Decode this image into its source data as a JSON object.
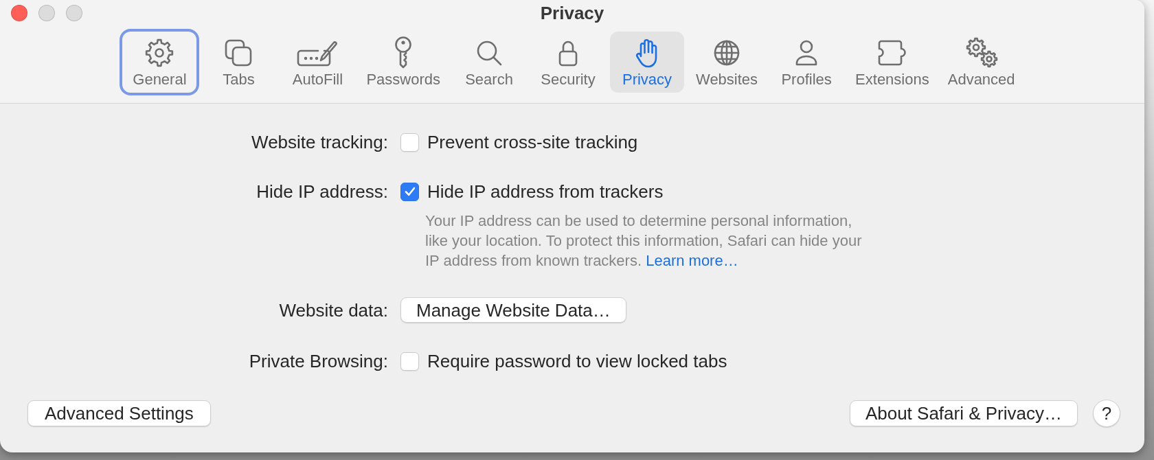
{
  "window": {
    "title": "Privacy",
    "controls": [
      {
        "color": "#ff5f57"
      },
      {
        "color": "#dcdcdc"
      },
      {
        "color": "#dcdcdc"
      }
    ]
  },
  "toolbar": [
    {
      "kind": "general",
      "label": "General",
      "selected": false,
      "focused": true
    },
    {
      "kind": "tabs",
      "label": "Tabs",
      "selected": false,
      "focused": false
    },
    {
      "kind": "autofill",
      "label": "AutoFill",
      "selected": false,
      "focused": false
    },
    {
      "kind": "passwords",
      "label": "Passwords",
      "selected": false,
      "focused": false
    },
    {
      "kind": "search",
      "label": "Search",
      "selected": false,
      "focused": false
    },
    {
      "kind": "security",
      "label": "Security",
      "selected": false,
      "focused": false
    },
    {
      "kind": "privacy",
      "label": "Privacy",
      "selected": true,
      "focused": false
    },
    {
      "kind": "websites",
      "label": "Websites",
      "selected": false,
      "focused": false
    },
    {
      "kind": "profiles",
      "label": "Profiles",
      "selected": false,
      "focused": false
    },
    {
      "kind": "extensions",
      "label": "Extensions",
      "selected": false,
      "focused": false
    },
    {
      "kind": "advanced",
      "label": "Advanced",
      "selected": false,
      "focused": false
    }
  ],
  "settings": [
    {
      "kind": "checkbox",
      "label": "Website tracking:",
      "text": "Prevent cross-site tracking",
      "checked": false
    },
    {
      "kind": "checkbox",
      "label": "Hide IP address:",
      "text": "Hide IP address from trackers",
      "checked": true,
      "note": {
        "text": "Your IP address can be used to determine personal information, like your location. To protect this information, Safari can hide your IP address from known trackers.",
        "link": "Learn more…"
      }
    },
    {
      "kind": "button",
      "label": "Website data:",
      "button": "Manage Website Data…"
    },
    {
      "kind": "checkbox",
      "label": "Private Browsing:",
      "text": "Require password to view locked tabs",
      "checked": false
    }
  ],
  "footer": {
    "left_button": "Advanced Settings",
    "right_button": "About Safari & Privacy…",
    "help_button": "?"
  }
}
